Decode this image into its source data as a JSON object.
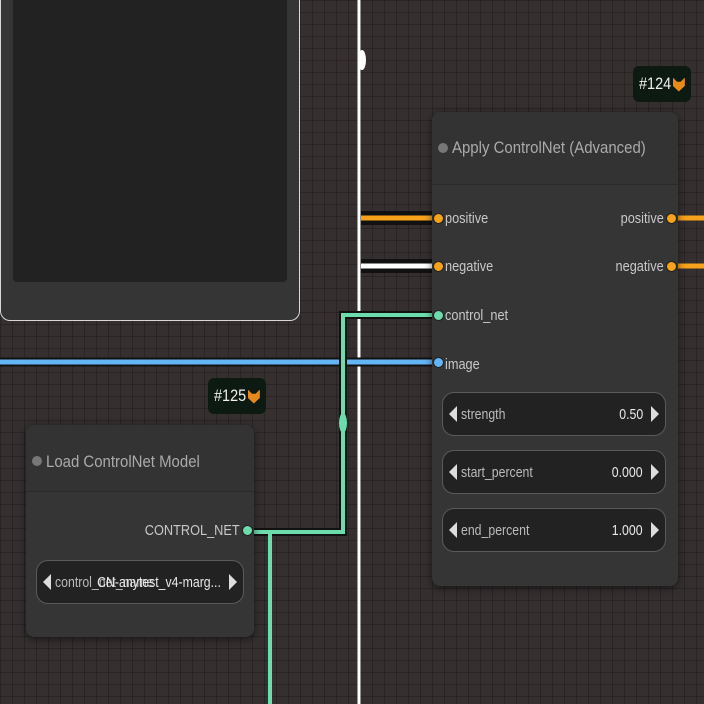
{
  "colors": {
    "canvas": "#352f30",
    "node_bg": "#353535",
    "conditioning": "#f7a21b",
    "control_net": "#6ddcad",
    "image": "#64b5f6",
    "white_wire": "#ffffff"
  },
  "apply_node": {
    "badge": "#124",
    "badge_icon": "fox-icon",
    "title": "Apply ControlNet (Advanced)",
    "inputs": [
      "positive",
      "negative",
      "control_net",
      "image"
    ],
    "outputs": [
      "positive",
      "negative"
    ],
    "widgets": [
      {
        "label": "strength",
        "value": "0.50"
      },
      {
        "label": "start_percent",
        "value": "0.000"
      },
      {
        "label": "end_percent",
        "value": "1.000"
      }
    ]
  },
  "load_node": {
    "badge": "#125",
    "badge_icon": "fox-icon",
    "title": "Load ControlNet Model",
    "output": "CONTROL_NET",
    "widget": {
      "label": "control_net_name",
      "value": "CN-anytest_v4-marg..."
    }
  }
}
